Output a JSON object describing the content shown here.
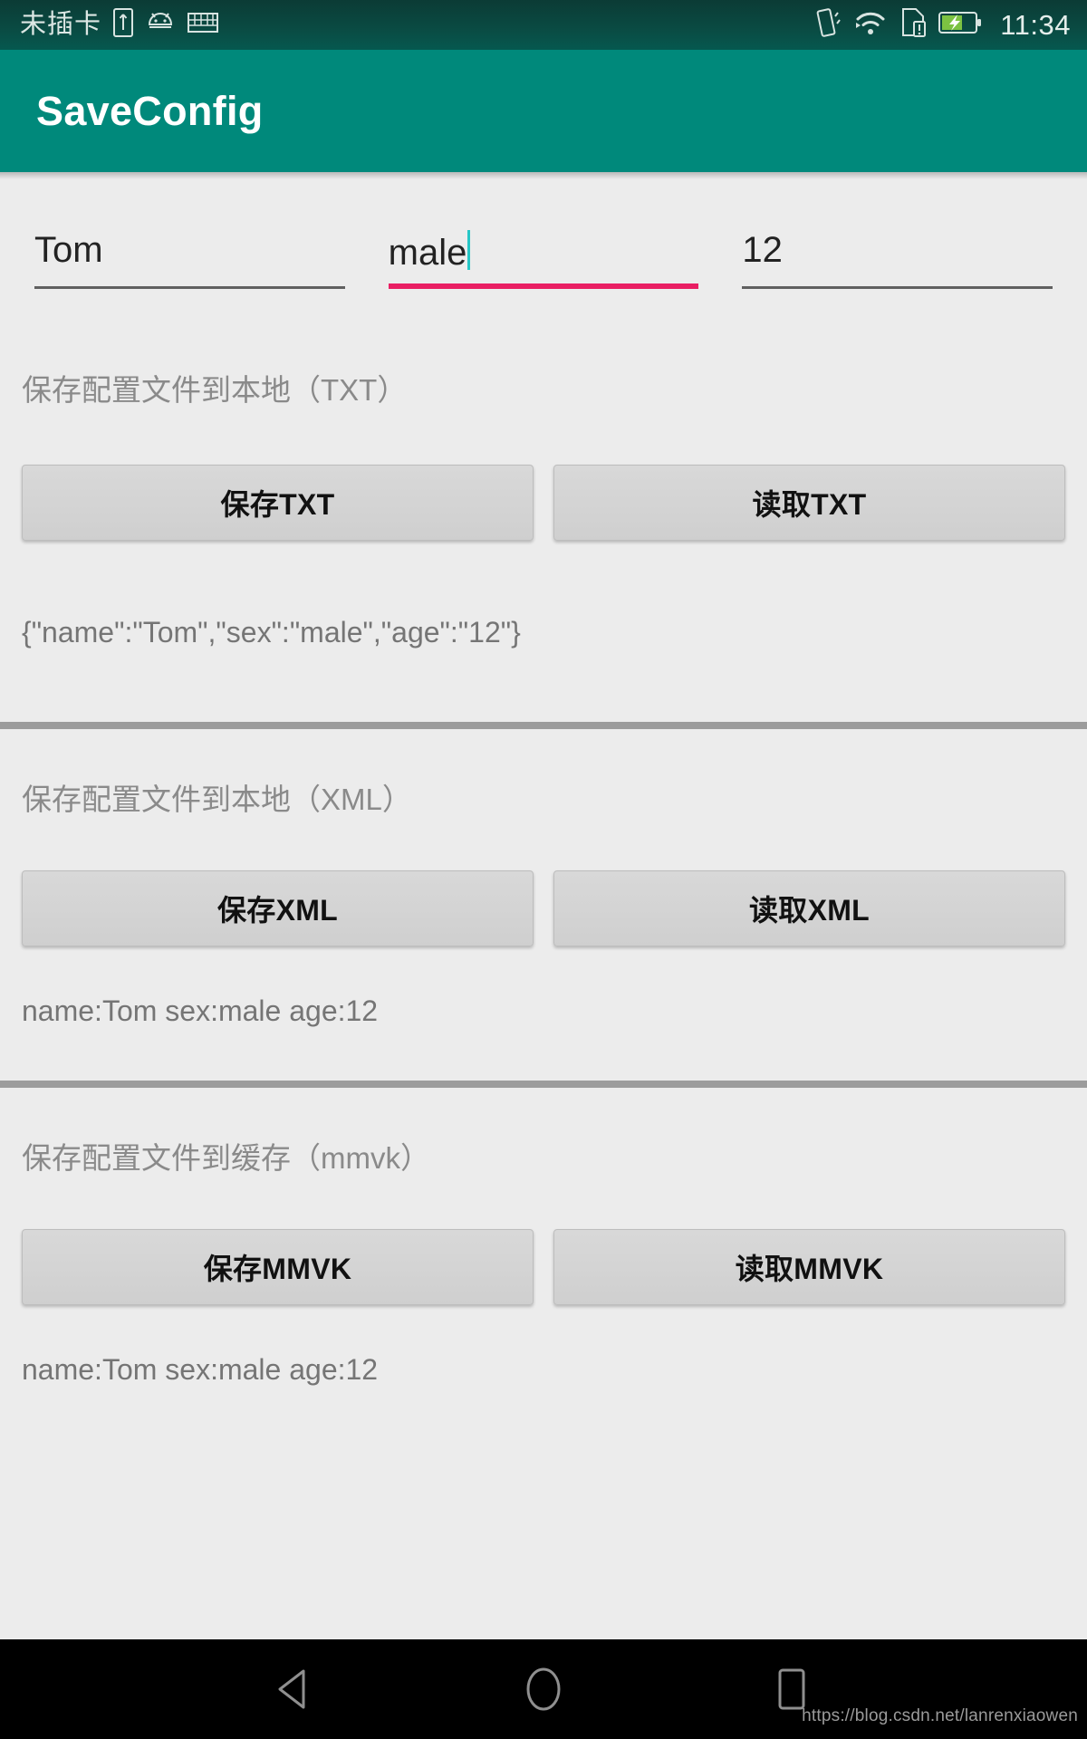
{
  "statusbar": {
    "carrier": "未插卡",
    "time": "11:34",
    "icons": [
      "sim-card-icon",
      "android-robot-icon",
      "keyboard-icon",
      "vibrate-icon",
      "wifi-icon",
      "sim-card-alert-icon",
      "battery-charging-icon"
    ]
  },
  "appbar": {
    "title": "SaveConfig"
  },
  "form": {
    "name_value": "Tom",
    "sex_value": "male",
    "age_value": "12"
  },
  "sections": [
    {
      "label": "保存配置文件到本地（TXT）",
      "save_label": "保存TXT",
      "read_label": "读取TXT",
      "result": "{\"name\":\"Tom\",\"sex\":\"male\",\"age\":\"12\"}"
    },
    {
      "label": "保存配置文件到本地（XML）",
      "save_label": "保存XML",
      "read_label": "读取XML",
      "result": "name:Tom sex:male age:12"
    },
    {
      "label": "保存配置文件到缓存（mmvk）",
      "save_label": "保存MMVK",
      "read_label": "读取MMVK",
      "result": "name:Tom sex:male age:12"
    }
  ],
  "navbar": {
    "back_label": "back-button",
    "home_label": "home-button",
    "recents_label": "recents-button",
    "watermark": "https://blog.csdn.net/lanrenxiaowen"
  },
  "colors": {
    "primary": "#00897b",
    "statusbar": "#0a4a42",
    "focus_underline": "#e91e63",
    "caret": "#26c6c6",
    "background": "#ececec",
    "divider": "#9c9c9c"
  }
}
